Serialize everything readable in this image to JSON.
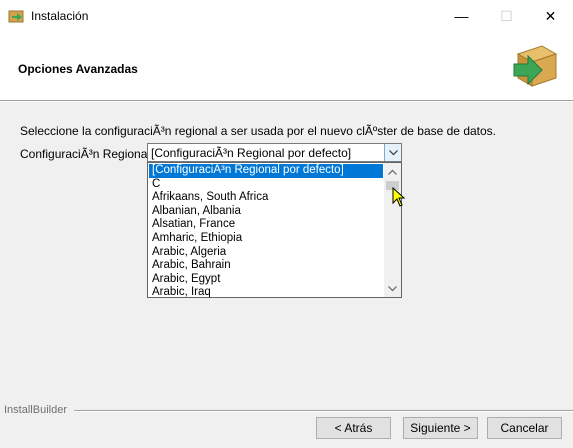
{
  "window": {
    "title": "Instalación",
    "controls": {
      "minimize": "—",
      "maximize": "☐",
      "close": "✕"
    }
  },
  "header": {
    "title": "Opciones Avanzadas",
    "logo_icon": "installer-box-arrow-icon"
  },
  "main": {
    "description": "Seleccione la configuraciÃ³n regional a ser usada por el nuevo clÃºster de base de datos.",
    "locale_label": "ConfiguraciÃ³n Regional",
    "locale_value": "[ConfiguraciÃ³n Regional por defecto]",
    "dropdown_options": [
      "[ConfiguraciÃ³n Regional por defecto]",
      "C",
      "Afrikaans, South Africa",
      "Albanian, Albania",
      "Alsatian, France",
      "Amharic, Ethiopia",
      "Arabic, Algeria",
      "Arabic, Bahrain",
      "Arabic, Egypt",
      "Arabic, Iraq"
    ],
    "selected_index": 0
  },
  "footer": {
    "brand": "InstallBuilder",
    "back_label": "< Atrás",
    "next_label": "Siguiente >",
    "cancel_label": "Cancelar"
  },
  "colors": {
    "selection": "#0078d7",
    "logo_box": "#d4a24a",
    "logo_arrow": "#3aa656"
  }
}
